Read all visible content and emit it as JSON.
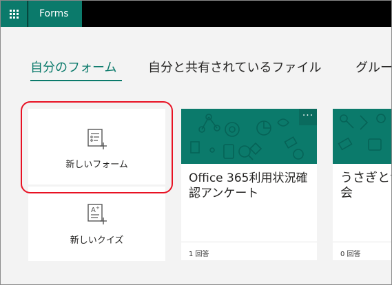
{
  "app": {
    "name": "Forms",
    "brand_color": "#0b7a6b",
    "topbar_color": "#000000"
  },
  "tabs": [
    {
      "label": "自分のフォーム",
      "active": true
    },
    {
      "label": "自分と共有されているファイル",
      "active": false
    },
    {
      "label": "グルー",
      "active": false
    }
  ],
  "new_items": {
    "new_form": {
      "label": "新しいフォーム",
      "icon": "new-form-icon"
    },
    "new_quiz": {
      "label": "新しいクイズ",
      "icon": "new-quiz-icon"
    }
  },
  "highlight_color": "#e81123",
  "forms": [
    {
      "title": "Office 365利用状況確認アンケート",
      "responses": "1 回答",
      "more_label": "···"
    },
    {
      "title": "うさぎと食事会",
      "responses": "0 回答"
    }
  ]
}
